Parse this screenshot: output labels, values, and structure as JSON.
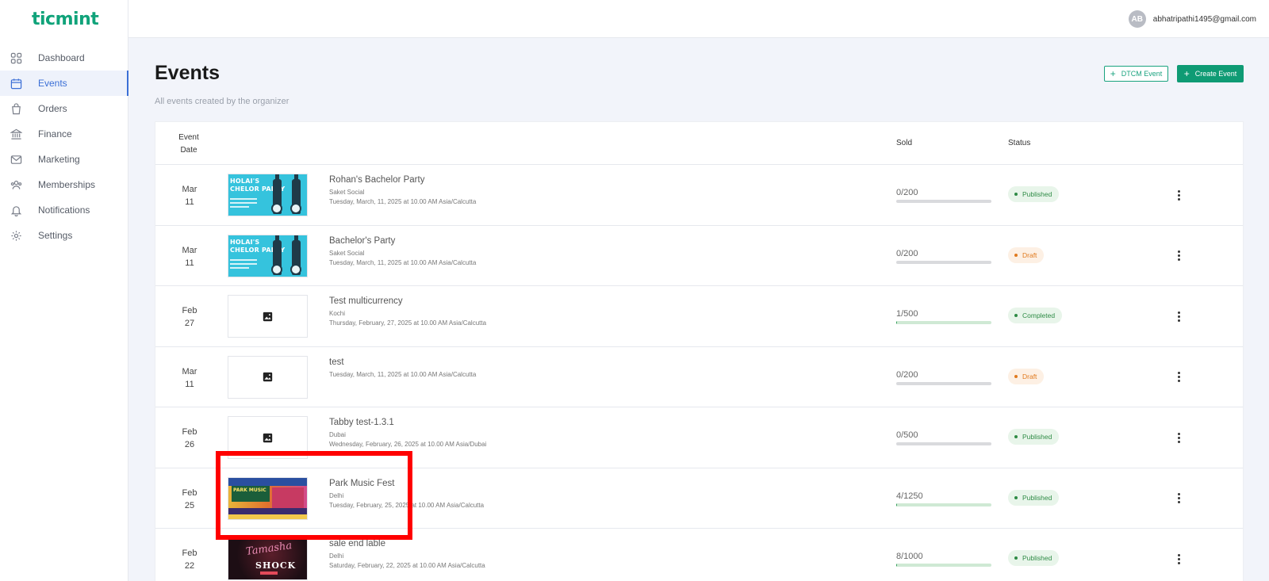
{
  "brand": {
    "logo_text": "ticmint",
    "accent": "#10a37a"
  },
  "sidebar": {
    "items": [
      {
        "label": "Dashboard",
        "icon": "grid-icon",
        "active": false
      },
      {
        "label": "Events",
        "icon": "calendar-icon",
        "active": true
      },
      {
        "label": "Orders",
        "icon": "shopping-bag-icon",
        "active": false
      },
      {
        "label": "Finance",
        "icon": "bank-icon",
        "active": false
      },
      {
        "label": "Marketing",
        "icon": "mail-icon",
        "active": false
      },
      {
        "label": "Memberships",
        "icon": "users-icon",
        "active": false
      },
      {
        "label": "Notifications",
        "icon": "bell-icon",
        "active": false
      },
      {
        "label": "Settings",
        "icon": "gear-icon",
        "active": false
      }
    ]
  },
  "topbar": {
    "avatar_initials": "AB",
    "email": "abhatripathi1495@gmail.com"
  },
  "header": {
    "title": "Events",
    "subtitle": "All events created by the organizer",
    "dtcm_button": "DTCM Event",
    "create_button": "Create Event"
  },
  "table": {
    "columns": {
      "date": "Event Date",
      "sold": "Sold",
      "status": "Status"
    },
    "rows": [
      {
        "month": "Mar",
        "day": "11",
        "name": "Rohan's Bachelor Party",
        "venue": "Saket Social",
        "when": "Tuesday, March, 11, 2025 at 10.00 AM Asia/Calcutta",
        "sold": "0/200",
        "sold_fraction": 0,
        "status": "Published",
        "thumb": "cyan"
      },
      {
        "month": "Mar",
        "day": "11",
        "name": "Bachelor's Party",
        "venue": "Saket Social",
        "when": "Tuesday, March, 11, 2025 at 10.00 AM Asia/Calcutta",
        "sold": "0/200",
        "sold_fraction": 0,
        "status": "Draft",
        "thumb": "cyan"
      },
      {
        "month": "Feb",
        "day": "27",
        "name": "Test multicurrency",
        "venue": "Kochi",
        "when": "Thursday, February, 27, 2025 at 10.00 AM Asia/Calcutta",
        "sold": "1/500",
        "sold_fraction": 0.002,
        "status": "Completed",
        "thumb": "placeholder"
      },
      {
        "month": "Mar",
        "day": "11",
        "name": "test",
        "venue": "",
        "when": "Tuesday, March, 11, 2025 at 10.00 AM Asia/Calcutta",
        "sold": "0/200",
        "sold_fraction": 0,
        "status": "Draft",
        "thumb": "placeholder"
      },
      {
        "month": "Feb",
        "day": "26",
        "name": "Tabby test-1.3.1",
        "venue": "Dubai",
        "when": "Wednesday, February, 26, 2025 at 10.00 AM Asia/Dubai",
        "sold": "0/500",
        "sold_fraction": 0,
        "status": "Published",
        "thumb": "placeholder"
      },
      {
        "month": "Feb",
        "day": "25",
        "name": "Park Music Fest",
        "venue": "Delhi",
        "when": "Tuesday, February, 25, 2025 at 10.00 AM Asia/Calcutta",
        "sold": "4/1250",
        "sold_fraction": 0.0032,
        "status": "Published",
        "thumb": "park"
      },
      {
        "month": "Feb",
        "day": "22",
        "name": "sale end lable",
        "venue": "Delhi",
        "when": "Saturday, February, 22, 2025 at 10.00 AM Asia/Calcutta",
        "sold": "8/1000",
        "sold_fraction": 0.008,
        "status": "Published",
        "thumb": "dark"
      }
    ]
  },
  "status_colors": {
    "published": "#2e8b45",
    "draft": "#e07a1e",
    "completed": "#2e8b45"
  }
}
